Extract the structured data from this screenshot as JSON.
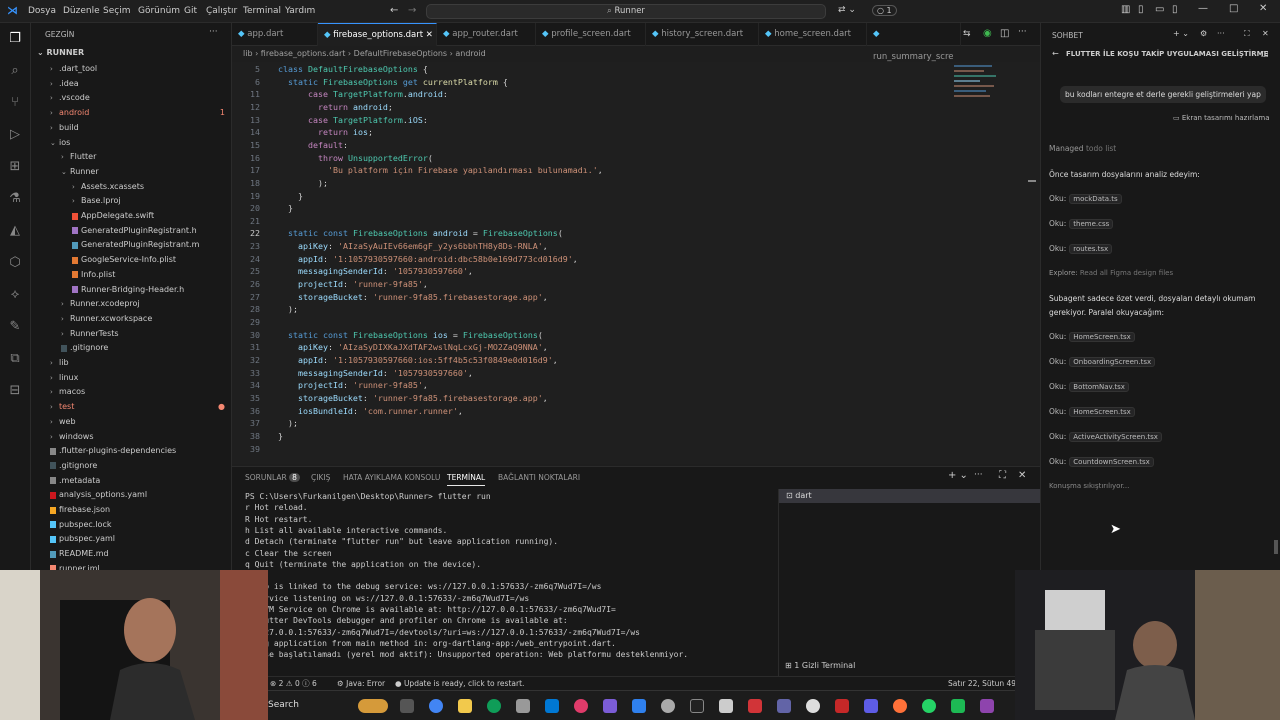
{
  "menu": [
    "Dosya",
    "Düzenle",
    "Seçim",
    "Görünüm",
    "Git",
    "Çalıştır",
    "Terminal",
    "Yardım"
  ],
  "search": {
    "text": "Runner"
  },
  "titlebar_right": {
    "count": "1"
  },
  "explorer": {
    "title": "GEZGİN",
    "root": "RUNNER",
    "items": [
      {
        "label": ".dart_tool",
        "indent": 1,
        "chev": "›",
        "color": "#ccc"
      },
      {
        "label": ".idea",
        "indent": 1,
        "chev": "›",
        "color": "#ccc"
      },
      {
        "label": ".vscode",
        "indent": 1,
        "chev": "›",
        "color": "#ccc"
      },
      {
        "label": "android",
        "indent": 1,
        "chev": "›",
        "color": "#f48771",
        "badge": "1"
      },
      {
        "label": "build",
        "indent": 1,
        "chev": "›",
        "color": "#ccc"
      },
      {
        "label": "ios",
        "indent": 1,
        "chev": "⌄",
        "color": "#ccc"
      },
      {
        "label": "Flutter",
        "indent": 2,
        "chev": "›",
        "color": "#ccc"
      },
      {
        "label": "Runner",
        "indent": 2,
        "chev": "⌄",
        "color": "#ccc"
      },
      {
        "label": "Assets.xcassets",
        "indent": 3,
        "chev": "›",
        "color": "#ccc"
      },
      {
        "label": "Base.lproj",
        "indent": 3,
        "chev": "›",
        "color": "#ccc"
      },
      {
        "label": "AppDelegate.swift",
        "indent": 3,
        "chev": "",
        "color": "#ccc",
        "icon": "#f05138"
      },
      {
        "label": "GeneratedPluginRegistrant.h",
        "indent": 3,
        "chev": "",
        "color": "#ccc",
        "icon": "#a074c4"
      },
      {
        "label": "GeneratedPluginRegistrant.m",
        "indent": 3,
        "chev": "",
        "color": "#ccc",
        "icon": "#519aba"
      },
      {
        "label": "GoogleService-Info.plist",
        "indent": 3,
        "chev": "",
        "color": "#ccc",
        "icon": "#e37933"
      },
      {
        "label": "Info.plist",
        "indent": 3,
        "chev": "",
        "color": "#ccc",
        "icon": "#e37933"
      },
      {
        "label": "Runner-Bridging-Header.h",
        "indent": 3,
        "chev": "",
        "color": "#ccc",
        "icon": "#a074c4"
      },
      {
        "label": "Runner.xcodeproj",
        "indent": 2,
        "chev": "›",
        "color": "#ccc"
      },
      {
        "label": "Runner.xcworkspace",
        "indent": 2,
        "chev": "›",
        "color": "#ccc"
      },
      {
        "label": "RunnerTests",
        "indent": 2,
        "chev": "›",
        "color": "#ccc"
      },
      {
        "label": ".gitignore",
        "indent": 2,
        "chev": "",
        "color": "#ccc",
        "icon": "#41535b"
      },
      {
        "label": "lib",
        "indent": 1,
        "chev": "›",
        "color": "#ccc"
      },
      {
        "label": "linux",
        "indent": 1,
        "chev": "›",
        "color": "#ccc"
      },
      {
        "label": "macos",
        "indent": 1,
        "chev": "›",
        "color": "#ccc"
      },
      {
        "label": "test",
        "indent": 1,
        "chev": "›",
        "color": "#f48771",
        "dot": true
      },
      {
        "label": "web",
        "indent": 1,
        "chev": "›",
        "color": "#ccc"
      },
      {
        "label": "windows",
        "indent": 1,
        "chev": "›",
        "color": "#ccc"
      },
      {
        "label": ".flutter-plugins-dependencies",
        "indent": 1,
        "chev": "",
        "color": "#ccc",
        "icon": "#888"
      },
      {
        "label": ".gitignore",
        "indent": 1,
        "chev": "",
        "color": "#ccc",
        "icon": "#41535b"
      },
      {
        "label": ".metadata",
        "indent": 1,
        "chev": "",
        "color": "#ccc",
        "icon": "#888"
      },
      {
        "label": "analysis_options.yaml",
        "indent": 1,
        "chev": "",
        "color": "#ccc",
        "icon": "#cb171e"
      },
      {
        "label": "firebase.json",
        "indent": 1,
        "chev": "",
        "color": "#ccc",
        "icon": "#f5a623"
      },
      {
        "label": "pubspec.lock",
        "indent": 1,
        "chev": "",
        "color": "#ccc",
        "icon": "#54c5f8"
      },
      {
        "label": "pubspec.yaml",
        "indent": 1,
        "chev": "",
        "color": "#ccc",
        "icon": "#54c5f8"
      },
      {
        "label": "README.md",
        "indent": 1,
        "chev": "",
        "color": "#ccc",
        "icon": "#519aba"
      },
      {
        "label": "runner.iml",
        "indent": 1,
        "chev": "",
        "color": "#ccc",
        "icon": "#f48771"
      }
    ]
  },
  "tabs": [
    {
      "label": "app.dart",
      "active": false
    },
    {
      "label": "firebase_options.dart",
      "active": true
    },
    {
      "label": "app_router.dart",
      "active": false
    },
    {
      "label": "profile_screen.dart",
      "active": false
    },
    {
      "label": "history_screen.dart",
      "active": false
    },
    {
      "label": "home_screen.dart",
      "active": false
    },
    {
      "label": "run_summary_scre",
      "active": false
    }
  ],
  "breadcrumb": "lib › firebase_options.dart › DefaultFirebaseOptions › android",
  "code": [
    {
      "n": "5",
      "t": "<span class='kw'>class</span> <span class='ty'>DefaultFirebaseOptions</span> {"
    },
    {
      "n": "6",
      "t": "  <span class='kw'>static</span> <span class='ty'>FirebaseOptions</span> <span class='kw'>get</span> <span class='fn'>currentPlatform</span> {"
    },
    {
      "n": "11",
      "t": "      <span class='ct'>case</span> <span class='ty'>TargetPlatform</span>.<span class='pr'>android</span>:"
    },
    {
      "n": "12",
      "t": "        <span class='ct'>return</span> <span class='pr'>android</span>;"
    },
    {
      "n": "13",
      "t": "      <span class='ct'>case</span> <span class='ty'>TargetPlatform</span>.<span class='pr'>iOS</span>:"
    },
    {
      "n": "14",
      "t": "        <span class='ct'>return</span> <span class='pr'>ios</span>;"
    },
    {
      "n": "15",
      "t": "      <span class='ct'>default</span>:"
    },
    {
      "n": "16",
      "t": "        <span class='ct'>throw</span> <span class='ty'>UnsupportedError</span>("
    },
    {
      "n": "17",
      "t": "          <span class='str'>'Bu platform için Firebase yapılandırması bulunamadı.'</span>,"
    },
    {
      "n": "18",
      "t": "        );"
    },
    {
      "n": "19",
      "t": "    }"
    },
    {
      "n": "20",
      "t": "  }"
    },
    {
      "n": "21",
      "t": ""
    },
    {
      "n": "22",
      "t": "  <span class='kw'>static</span> <span class='kw'>const</span> <span class='ty'>FirebaseOptions</span> <span class='pr'>android</span> = <span class='ty'>FirebaseOptions</span>("
    },
    {
      "n": "23",
      "t": "    <span class='pr'>apiKey</span>: <span class='str'>'AIzaSyAuIEv66em6gF_y2ys6bbhTH8y8Ds-RNLA'</span>,"
    },
    {
      "n": "24",
      "t": "    <span class='pr'>appId</span>: <span class='str'>'1:1057930597660:android:dbc58b0e169d773cd016d9'</span>,"
    },
    {
      "n": "25",
      "t": "    <span class='pr'>messagingSenderId</span>: <span class='str'>'1057930597660'</span>,"
    },
    {
      "n": "26",
      "t": "    <span class='pr'>projectId</span>: <span class='str'>'runner-9fa85'</span>,"
    },
    {
      "n": "27",
      "t": "    <span class='pr'>storageBucket</span>: <span class='str'>'runner-9fa85.firebasestorage.app'</span>,"
    },
    {
      "n": "28",
      "t": "  );"
    },
    {
      "n": "29",
      "t": ""
    },
    {
      "n": "30",
      "t": "  <span class='kw'>static</span> <span class='kw'>const</span> <span class='ty'>FirebaseOptions</span> <span class='pr'>ios</span> = <span class='ty'>FirebaseOptions</span>("
    },
    {
      "n": "31",
      "t": "    <span class='pr'>apiKey</span>: <span class='str'>'AIzaSyDIXKaJXdTAF2wslNqLcxGj-MO2ZaQ9NNA'</span>,"
    },
    {
      "n": "32",
      "t": "    <span class='pr'>appId</span>: <span class='str'>'1:1057930597660:ios:5ff4b5c53f0849e0d016d9'</span>,"
    },
    {
      "n": "33",
      "t": "    <span class='pr'>messagingSenderId</span>: <span class='str'>'1057930597660'</span>,"
    },
    {
      "n": "34",
      "t": "    <span class='pr'>projectId</span>: <span class='str'>'runner-9fa85'</span>,"
    },
    {
      "n": "35",
      "t": "    <span class='pr'>storageBucket</span>: <span class='str'>'runner-9fa85.firebasestorage.app'</span>,"
    },
    {
      "n": "36",
      "t": "    <span class='pr'>iosBundleId</span>: <span class='str'>'com.runner.runner'</span>,"
    },
    {
      "n": "37",
      "t": "  );"
    },
    {
      "n": "38",
      "t": "}"
    },
    {
      "n": "39",
      "t": ""
    }
  ],
  "panel": {
    "tabs": [
      "SORUNLAR",
      "ÇIKIŞ",
      "HATA AYIKLAMA KONSOLU",
      "TERMİNAL",
      "BAĞLANTI NOKTALARI"
    ],
    "problems_count": "8",
    "terminal_label": "dart",
    "hidden_terminal": "1 Gizli Terminal",
    "lines": [
      "PS C:\\Users\\Furkanilgen\\Desktop\\Runner> flutter run",
      "r Hot reload.",
      "R Hot restart.",
      "h List all available interactive commands.",
      "d Detach (terminate \"flutter run\" but leave application running).",
      "c Clear the screen",
      "q Quit (terminate the application on the device).",
      "",
      "  app is linked to the debug service: ws://127.0.0.1:57633/-zm6q7Wud7I=/ws",
      "  service listening on ws://127.0.0.1:57633/-zm6q7Wud7I=/ws",
      "  t VM Service on Chrome is available at: http://127.0.0.1:57633/-zm6q7Wud7I=",
      "  Flutter DevTools debugger and profiler on Chrome is available at:",
      "  /127.0.0.1:57633/-zm6q7Wud7I=/devtools/?uri=ws://127.0.0.1:57633/-zm6q7Wud7I=/ws",
      "  ing application from main method in: org-dartlang-app:/web_entrypoint.dart.",
      "  base başlatılamadı (yerel mod aktif): Unsupported operation: Web platformu desteklenmiyor."
    ]
  },
  "status": {
    "errors": "2",
    "warnings": "0",
    "info": "6",
    "java": "Java: Error",
    "update": "Update is ready, click to restart.",
    "position": "Satır 22, Sütun 49"
  },
  "taskbar": {
    "search": "Search"
  },
  "chat": {
    "title": "SOHBET",
    "header": "FLUTTER İLE KOŞU TAKİP UYGULAMASI GELİŞTİRME",
    "user_msg": "bu kodları entegre et derle gerekli geliştirmeleri yap",
    "attachment": "Ekran tasarımı hazırlama",
    "managed": "Managed",
    "todo": "todo list",
    "intro": "Önce tasarım dosyalarını analiz edeyim:",
    "oku1": [
      {
        "k": "Oku:",
        "f": "mockData.ts"
      },
      {
        "k": "Oku:",
        "f": "theme.css"
      },
      {
        "k": "Oku:",
        "f": "routes.tsx"
      }
    ],
    "explore_k": "Explore:",
    "explore": "Read all Figma design files",
    "sub1": "Subagent sadece özet verdi, dosyaları detaylı okumam",
    "sub2": "gerekiyor. Paralel okuyacağım:",
    "oku2": [
      {
        "k": "Oku:",
        "f": "HomeScreen.tsx"
      },
      {
        "k": "Oku:",
        "f": "OnboardingScreen.tsx"
      },
      {
        "k": "Oku:",
        "f": "BottomNav.tsx"
      },
      {
        "k": "Oku:",
        "f": "HomeScreen.tsx"
      },
      {
        "k": "Oku:",
        "f": "ActiveActivityScreen.tsx"
      },
      {
        "k": "Oku:",
        "f": "CountdownScreen.tsx"
      }
    ],
    "compacting": "Konuşma sıkıştırılıyor..."
  }
}
